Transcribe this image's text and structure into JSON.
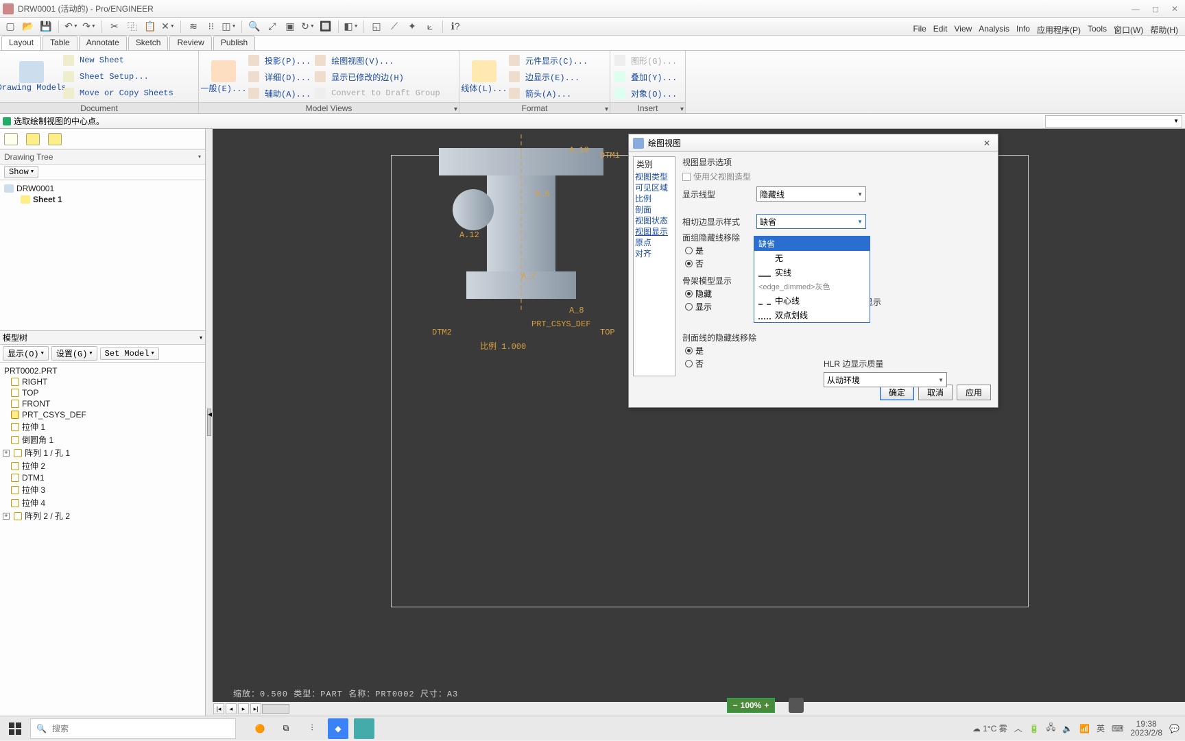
{
  "window": {
    "title": "DRW0001 (活动的) - Pro/ENGINEER"
  },
  "menus": [
    "File",
    "Edit",
    "View",
    "Analysis",
    "Info",
    "应用程序(P)",
    "Tools",
    "窗口(W)",
    "帮助(H)"
  ],
  "tabs": [
    "Layout",
    "Table",
    "Annotate",
    "Sketch",
    "Review",
    "Publish"
  ],
  "ribbon": {
    "g1": {
      "big": "Drawing Models",
      "items": [
        "New Sheet",
        "Sheet Setup...",
        "Move or Copy Sheets"
      ],
      "label": "Document"
    },
    "g2": {
      "big": "一般(E)...",
      "c1": [
        "投影(P)...",
        "详细(D)...",
        "辅助(A)..."
      ],
      "c2": [
        "绘图视图(V)...",
        "显示已修改的边(H)",
        "Convert to Draft Group"
      ],
      "label": "Model Views"
    },
    "g3": {
      "big": "线体(L)...",
      "c": [
        "元件显示(C)...",
        "边显示(E)...",
        "箭头(A)..."
      ],
      "label": "Format"
    },
    "g4": {
      "c": [
        "图形(G)...",
        "叠加(Y)...",
        "对象(O)..."
      ],
      "disabled0": true,
      "label": "Insert"
    }
  },
  "prompt": "选取绘制视图的中心点。",
  "drawing_tree": {
    "title": "Drawing Tree",
    "show": "Show",
    "root": "DRW0001",
    "child": "Sheet 1"
  },
  "modeltree": {
    "title": "模型树",
    "btns": [
      "显示(O)",
      "设置(G)",
      "Set Model"
    ],
    "root": "PRT0002.PRT",
    "items": [
      "RIGHT",
      "TOP",
      "FRONT",
      "PRT_CSYS_DEF",
      "拉伸 1",
      "倒圆角 1",
      "阵列 1 / 孔 1",
      "拉伸 2",
      "DTM1",
      "拉伸 3",
      "拉伸 4",
      "阵列 2 / 孔 2"
    ]
  },
  "gfx": {
    "status": "缩放：0.500   类型：PART   名称：PRT0002   尺寸：A3",
    "ann_top": "A_10",
    "ann_dtm1": "DTM1",
    "ann_a7": "A_7",
    "ann_a6": "A_6",
    "ann_a12": "A.12",
    "ann_a8": "A_8",
    "ann_csys": "PRT_CSYS_DEF",
    "ann_top2": "TOP",
    "ann_dtm2": "DTM2",
    "ann_scale": "比例  1.000"
  },
  "dlg": {
    "title": "绘图视图",
    "cat_label": "类别",
    "cats": [
      "视图类型",
      "可见区域",
      "比例",
      "剖面",
      "视图状态",
      "视图显示",
      "原点",
      "对齐"
    ],
    "sel_cat": 5,
    "section": "视图显示选项",
    "chk": "使用父视图造型",
    "row1_lbl": "显示线型",
    "row1_val": "隐藏线",
    "row2_lbl": "相切边显示样式",
    "row2_val": "缺省",
    "drop": [
      "缺省",
      "无",
      "实线",
      "<edge_dimmed>灰色",
      "中心线",
      "双点划线"
    ],
    "grp3_lbl": "面组隐藏线移除",
    "yes": "是",
    "no": "否",
    "grp4_lbl": "骨架模型显示",
    "hide": "隐藏",
    "show": "显示",
    "grp4r_lbl": "显示",
    "grp5_lbl": "剖面线的隐藏线移除",
    "hlr_lbl": "HLR 边显示质量",
    "hlr_val": "从动环境",
    "btns": [
      "确定",
      "取消",
      "应用"
    ]
  },
  "taskbar": {
    "search": "搜索",
    "weather": "1°C 雾",
    "ime": "英",
    "time": "19:38",
    "date": "2023/2/8"
  },
  "zoom": "100%"
}
